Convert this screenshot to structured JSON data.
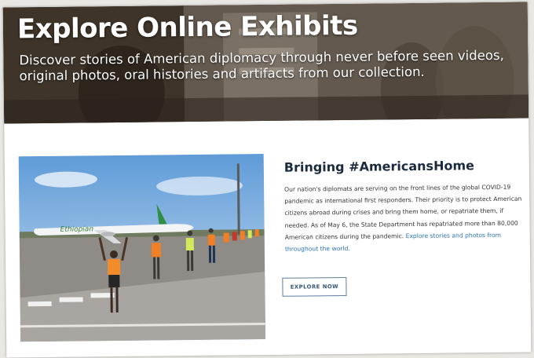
{
  "hero": {
    "title": "Explore Online Exhibits",
    "subtitle": "Discover stories of American diplomacy through never before seen videos, original photos, oral histories and artifacts from our collection."
  },
  "feature": {
    "title": "Bringing #AmericansHome",
    "body": "Our nation's diplomats are serving on the front lines of the global COVID-19 pandemic as international first responders. Their priority is to protect American citizens abroad during crises and bring them home, or repatriate them, if needed. As of May 6, the State Department has repatriated more than 80,000 American citizens during the pandemic.",
    "link_text": "Explore stories and photos from throughout the world.",
    "button_label": "EXPLORE NOW",
    "image_airline_text": "Ethiopian"
  },
  "colors": {
    "hero_overlay": "#4a4035",
    "title_text": "#1b2a3e",
    "link": "#2a73b8",
    "button_border": "#5b7fa0"
  }
}
